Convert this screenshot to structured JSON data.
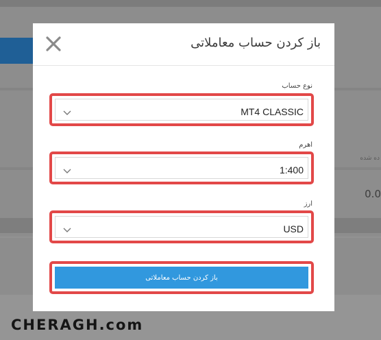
{
  "background": {
    "small_text": "ده شده",
    "number_text": "0.0"
  },
  "modal": {
    "title": "باز کردن حساب معاملاتی",
    "close_icon": "close-icon",
    "fields": [
      {
        "label": "نوع حساب",
        "value": "MT4 CLASSIC"
      },
      {
        "label": "اهرم",
        "value": "1:400"
      },
      {
        "label": "ارز",
        "value": "USD"
      }
    ],
    "submit_label": "باز کردن حساب معاملاتی"
  },
  "watermark": {
    "logo_text": "CHERAGH.com"
  },
  "colors": {
    "highlight_outline": "#e24848",
    "button_blue": "#3198de",
    "overlay_gray": "#8d8d8d"
  }
}
